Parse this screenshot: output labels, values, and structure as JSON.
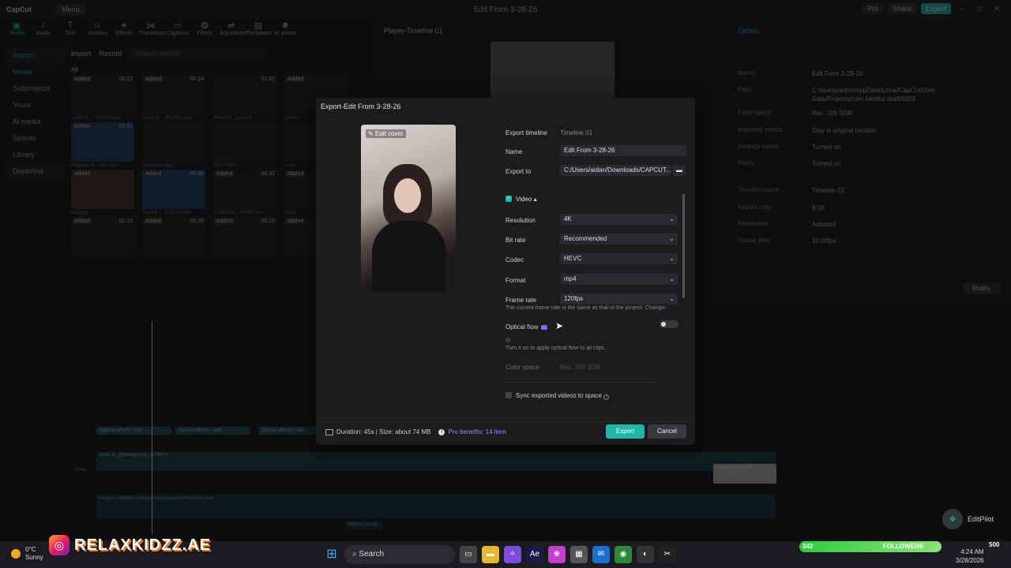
{
  "window": {
    "logo": "CapCut",
    "menu": "Menu",
    "title": "Edit From 3-28-26",
    "pro": "Pro",
    "share": "Share",
    "export": "Export"
  },
  "toolbar": [
    "Media",
    "Audio",
    "Text",
    "Stickers",
    "Effects",
    "Transitions",
    "Captions",
    "Filters",
    "Adjustment",
    "Templates",
    "AI avatar"
  ],
  "sidebar": [
    "Import",
    "Media",
    "Subprojects",
    "Yours",
    "AI media",
    "Spaces",
    "Library",
    "Dreamina"
  ],
  "media": {
    "import": "Import",
    "record": "Record",
    "search_placeholder": "Search media",
    "all": "All",
    "thumbs": [
      {
        "badge": "Added",
        "duration": "00:12",
        "caption": "ssstik.io_...764359.mp4"
      },
      {
        "badge": "Added",
        "duration": "00:14",
        "caption": "ssstik.io_...692566.mp4"
      },
      {
        "badge": "",
        "duration": "01:00",
        "caption": "Waterfall...go.mp4"
      },
      {
        "badge": "Added",
        "duration": "",
        "caption": "Online..."
      },
      {
        "badge": "Added",
        "duration": "02:41",
        "caption": "Модель (М...blue.wav"
      },
      {
        "badge": "",
        "duration": "",
        "caption": "homebody.jpg"
      },
      {
        "badge": "",
        "duration": "",
        "caption": "659144538_..."
      },
      {
        "badge": "",
        "duration": "",
        "caption": "ssstik..."
      },
      {
        "badge": "Added",
        "duration": "",
        "caption": "ms3.jpg"
      },
      {
        "badge": "Added",
        "duration": "00:30",
        "caption": "original s...875176.mp3"
      },
      {
        "badge": "Added",
        "duration": "00:31",
        "caption": "ca0f9236e...9740d.mp4"
      },
      {
        "badge": "Added",
        "duration": "",
        "caption": "ssstik..."
      },
      {
        "badge": "Added",
        "duration": "00:13",
        "caption": ""
      },
      {
        "badge": "Added",
        "duration": "00:05",
        "caption": ""
      },
      {
        "badge": "Added",
        "duration": "00:10",
        "caption": ""
      },
      {
        "badge": "Added",
        "duration": "",
        "caption": ""
      }
    ]
  },
  "player": {
    "title": "Player-Timeline 01"
  },
  "details": {
    "title": "Details",
    "rows": [
      {
        "k": "Name:",
        "v": "Edit From 3-28-26"
      },
      {
        "k": "Path:",
        "v": "C:/Users/aidan/AppData/Local/CapCut/User Data/Projects/com.lveditor.draft/0328"
      },
      {
        "k": "Color space:",
        "v": "Rec. 709 SDR"
      },
      {
        "k": "Imported media:",
        "v": "Stay in original location"
      },
      {
        "k": "Arrange layers",
        "v": "Turned on"
      },
      {
        "k": "Proxy:",
        "v": "Turned on"
      },
      {
        "k": "Timeline name:",
        "v": "Timeline 01"
      },
      {
        "k": "Aspect ratio:",
        "v": "9:16"
      },
      {
        "k": "Resolution:",
        "v": "Adapted"
      },
      {
        "k": "Frame rate:",
        "v": "30.00fps"
      }
    ],
    "modify": "Modify"
  },
  "timeline": {
    "fx_labels": [
      "Special effects - edit",
      "Special effects - edit",
      "Special effects - edit"
    ],
    "clip_label": "ssstik.io_@lisanycraze_1774673",
    "cover": "Cover",
    "audio_label": "Модель (Model) (slowed)-slowedandreverbstudio.wav",
    "audio2": "original sound",
    "white_clip": "white 00:00:04:05"
  },
  "dialog": {
    "title": "Export-Edit From 3-28-26",
    "edit_cover": "Edit cover",
    "export_timeline_label": "Export timeline",
    "export_timeline_value": "Timeline 01",
    "name_label": "Name",
    "name_value": "Edit From 3-28-26",
    "export_to_label": "Export to",
    "export_to_value": "C:/Users/aidan/Downloads/CAPCUT...",
    "video_label": "Video",
    "resolution_label": "Resolution",
    "resolution_value": "4K",
    "bitrate_label": "Bit rate",
    "bitrate_value": "Recommended",
    "codec_label": "Codec",
    "codec_value": "HEVC",
    "format_label": "Format",
    "format_value": "mp4",
    "framerate_label": "Frame rate",
    "framerate_value": "120fps",
    "framerate_hint": "The current frame rate is the same as that of the project. Changin",
    "optical_flow_label": "Optical flow",
    "optical_hint": "Turn it on to apply optical flow to all clips.",
    "colorspace_label": "Color space",
    "colorspace_value": "Rec. 709 SDR",
    "sync_label": "Sync exported videos to space",
    "footer_info": "Duration: 45s | Size: about 74 MB",
    "pro_benefits": "Pro benefits: 14 item",
    "export_button": "Export",
    "cancel_button": "Cancel"
  },
  "editpilot": "EditPilot",
  "taskbar": {
    "temp": "0°C",
    "weather": "Sunny",
    "brand": "RELAXKIDZZ.AE",
    "search": "Search",
    "followers_count": "342",
    "followers_label": "FOLLOWERS",
    "followers_goal": "500",
    "time": "4:24 AM",
    "date": "3/28/2026"
  }
}
